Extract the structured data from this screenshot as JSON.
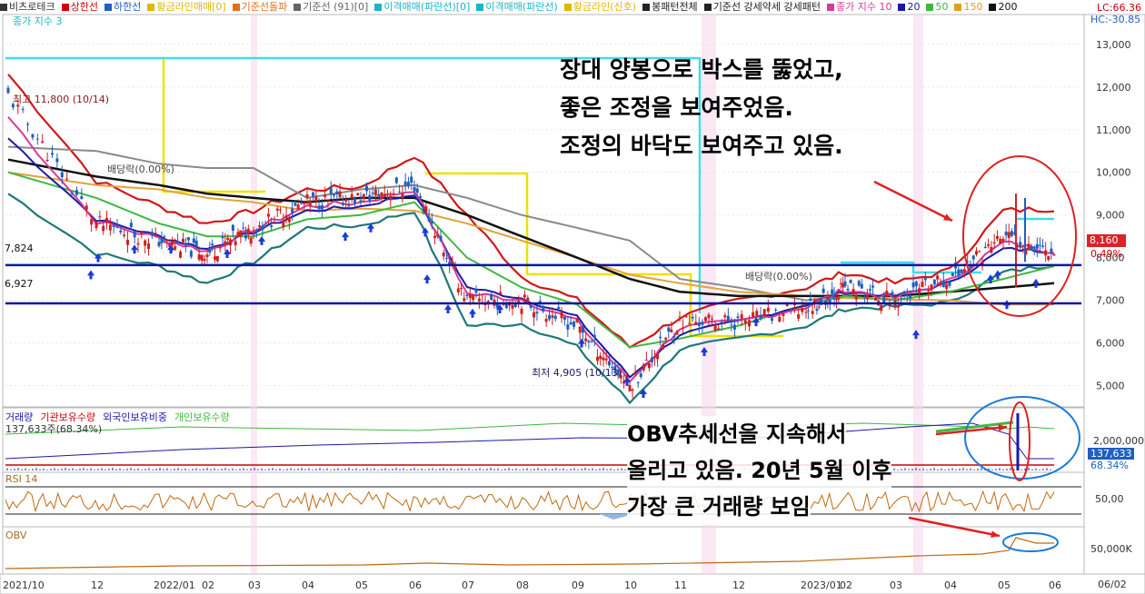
{
  "top_legend": [
    {
      "label": "비츠로테크",
      "color": "#333333"
    },
    {
      "label": "상한선",
      "color": "#d00000"
    },
    {
      "label": "하한선",
      "color": "#1f5fbf"
    },
    {
      "label": "황금라인매매[0]",
      "color": "#e0b800"
    },
    {
      "label": "기준선돌파",
      "color": "#e07020"
    },
    {
      "label": "기준선 (91)[0]",
      "color": "#666666"
    },
    {
      "label": "이격매매(파란선)[0]",
      "color": "#19b5c8"
    },
    {
      "label": "이격매매(파란선)",
      "color": "#19b5c8"
    },
    {
      "label": "황금라인(신호)",
      "color": "#e0b800"
    },
    {
      "label": "봉패턴전체",
      "color": "#222222"
    },
    {
      "label": "기준선 강세약세 강세패턴",
      "color": "#222222"
    },
    {
      "label": "종가 지수 10",
      "color": "#d83a9a"
    },
    {
      "label": "20",
      "color": "#1a1aa8"
    },
    {
      "label": "50",
      "color": "#3fb83f"
    },
    {
      "label": "150",
      "color": "#e0a020"
    },
    {
      "label": "200",
      "color": "#111111"
    }
  ],
  "sub_label": "종가 지수 3",
  "lc_label": "LC:66.36",
  "hc_label": "HC:-30.85",
  "price_axis": {
    "ticks": [
      "13,000",
      "12,000",
      "11,000",
      "10,000",
      "9,000",
      "8,000",
      "7,000",
      "6,000",
      "5,000"
    ],
    "min": 4500,
    "max": 13700
  },
  "current_price": "8,160",
  "current_pct": "0.49%",
  "h_levels": [
    "7,824",
    "6,927"
  ],
  "annotations": {
    "max_label": "최고 11,800 (10/14)",
    "min_label": "최저 4,905 (10/13)",
    "dividend1": "배당락(0.00%)",
    "dividend2": "배당락(0.00%)",
    "comment1": [
      "장대 양봉으로 박스를 뚫었고,",
      "좋은 조정을 보여주었음.",
      "조정의 바닥도 보여주고 있음."
    ],
    "comment2": [
      "OBV추세선을 지속해서",
      "올리고 있음. 20년 5월 이후",
      "가장 큰 거래량 보임"
    ]
  },
  "volume_panel": {
    "legend": [
      {
        "label": "거래량",
        "color": "#1a1aa8"
      },
      {
        "label": "기관보유수량",
        "color": "#d00000"
      },
      {
        "label": "외국인보유비중",
        "color": "#1a1aa8"
      },
      {
        "label": "개인보유수량",
        "color": "#3fb83f"
      }
    ],
    "info": "137,633주(68.34%)",
    "axis_tick": "2,000,000",
    "current_value": "137,633",
    "current_pct": "68.34%"
  },
  "rsi_panel": {
    "label": "RSI 14",
    "axis_tick": "50,00"
  },
  "obv_panel": {
    "label": "OBV",
    "axis_tick": "50,000K"
  },
  "date_axis": [
    "2021/10",
    "12",
    "2022/01",
    "02",
    "03",
    "04",
    "05",
    "06",
    "07",
    "08",
    "09",
    "10",
    "11",
    "12",
    "2023/01",
    "02",
    "03",
    "04",
    "05",
    "06"
  ],
  "date_axis_right": "06/02",
  "chart_data": {
    "type": "line",
    "title": "비츠로테크",
    "x": [
      "2021/10",
      "12",
      "2022/01",
      "02",
      "03",
      "04",
      "05",
      "06",
      "07",
      "08",
      "09",
      "10",
      "11",
      "12",
      "2023/01",
      "02",
      "03",
      "04",
      "05",
      "06"
    ],
    "series": [
      {
        "name": "비츠로테크",
        "values": [
          11800,
          8800,
          8400,
          8100,
          8700,
          9300,
          9400,
          9700,
          7000,
          7000,
          6400,
          5000,
          6500,
          6500,
          6800,
          7300,
          7000,
          7500,
          8500,
          8160
        ]
      },
      {
        "name": "20",
        "values": [
          10800,
          8900,
          8500,
          8200,
          8600,
          9100,
          9200,
          9500,
          7300,
          7050,
          6600,
          5200,
          6200,
          6500,
          6900,
          7200,
          7100,
          7400,
          8200,
          8150
        ]
      },
      {
        "name": "50",
        "values": [
          10000,
          9400,
          8800,
          8500,
          8500,
          8900,
          9000,
          9300,
          8000,
          7300,
          6900,
          5900,
          6100,
          6400,
          6900,
          7100,
          7000,
          7200,
          7500,
          7800
        ]
      },
      {
        "name": "200",
        "values": [
          10300,
          9900,
          9700,
          9500,
          9400,
          9300,
          9400,
          9400,
          9000,
          8500,
          8000,
          7500,
          7200,
          7100,
          7100,
          7100,
          7100,
          7200,
          7300,
          7400
        ]
      }
    ],
    "ylim": [
      4500,
      13700
    ],
    "h_lines": [
      7824,
      6927
    ],
    "extremes": {
      "max": {
        "label": "최고 11,800 (10/14)",
        "value": 11800
      },
      "min": {
        "label": "최저 4,905 (10/13)",
        "value": 4905
      }
    }
  }
}
